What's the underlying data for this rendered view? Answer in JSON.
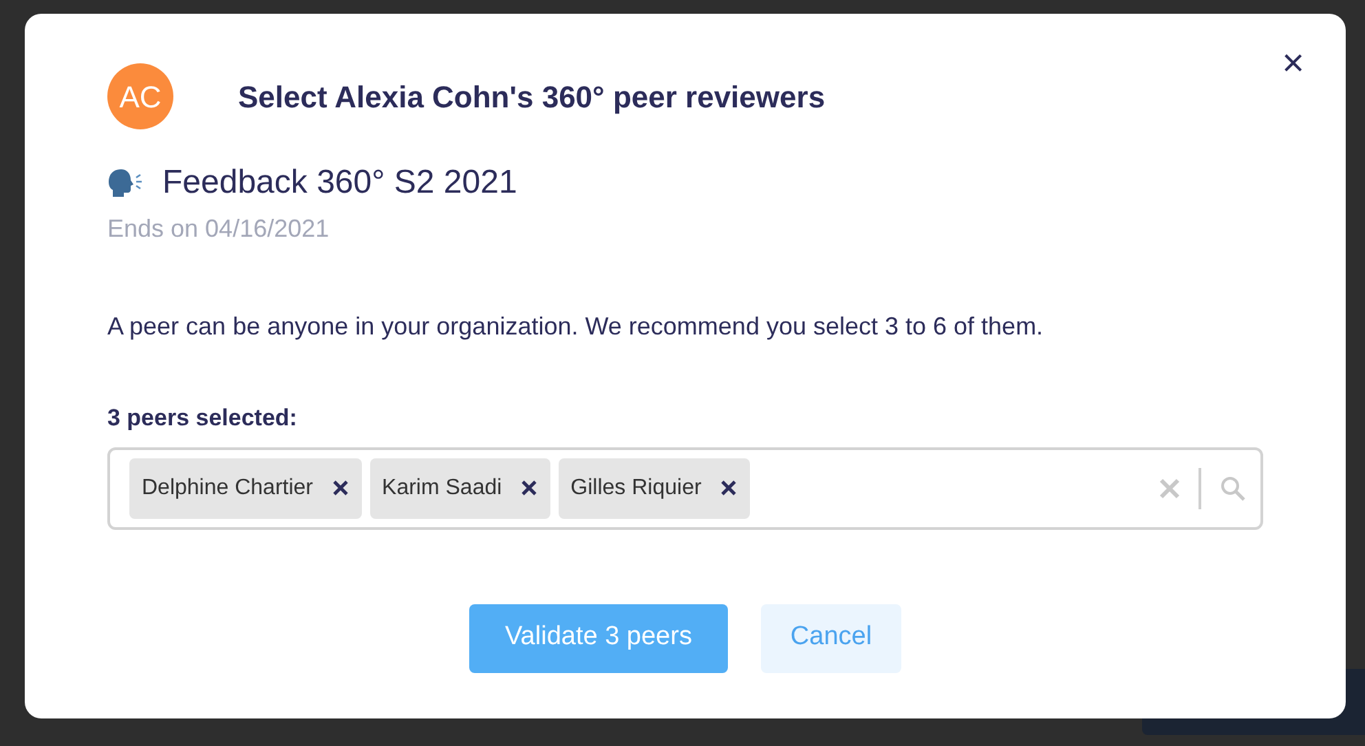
{
  "dialog": {
    "avatar_initials": "AC",
    "title": "Select Alexia Cohn's 360° peer reviewers",
    "close": "×",
    "campaign": {
      "title": "Feedback 360° S2 2021",
      "ends": "Ends on 04/16/2021"
    },
    "description": "A peer can be anyone in your organization. We recommend you select 3 to 6 of them.",
    "selection_label": "3 peers selected:",
    "selected_peers": [
      {
        "name": "Delphine Chartier"
      },
      {
        "name": "Karim Saadi"
      },
      {
        "name": "Gilles Riquier"
      }
    ],
    "buttons": [
      {
        "label": "Validate 3 peers",
        "kind": "primary"
      },
      {
        "label": "Cancel",
        "kind": "secondary"
      }
    ]
  }
}
